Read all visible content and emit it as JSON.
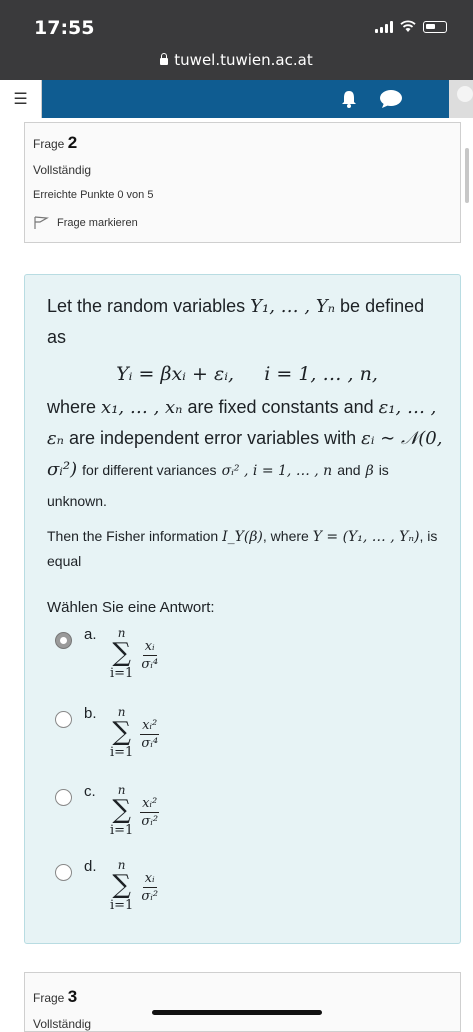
{
  "status_bar": {
    "time": "17:55",
    "url": "tuwel.tuwien.ac.at"
  },
  "nav": {
    "menu_icon": "hamburger-icon",
    "notification_icon": "bell-icon",
    "message_icon": "chat-icon",
    "brand_color": "#0f5c91"
  },
  "question_info": {
    "label": "Frage",
    "number": "2",
    "state": "Vollständig",
    "grade": "Erreichte Punkte 0 von 5",
    "flag_label": "Frage markieren"
  },
  "question": {
    "p1_a": "Let the random variables",
    "p1_vars": "Y₁, … , Yₙ",
    "p1_b": "be defined as",
    "equation": "Yᵢ = βxᵢ + εᵢ,     i = 1, … , n,",
    "p2_a": "where",
    "p2_x": "x₁, … , xₙ",
    "p2_b": "are fixed constants and",
    "p2_eps": "ε₁, … , εₙ",
    "p2_c": "are independent error variables with",
    "p2_dist": "εᵢ ∼ 𝒩(0, σᵢ²)",
    "p2_d": "for different variances",
    "p2_var": "σᵢ² , i = 1, … , n",
    "p2_e": "and",
    "p2_beta": "β",
    "p2_f": "is unknown.",
    "p3_a": "Then the Fisher information",
    "p3_info": "I_Y(β)",
    "p3_b": ", where",
    "p3_y": "Y = (Y₁, … , Yₙ)",
    "p3_c": ", is equal",
    "prompt": "Wählen Sie eine Antwort:"
  },
  "options": [
    {
      "label": "a.",
      "sum_top": "n",
      "sum_bottom": "i=1",
      "num": "xᵢ",
      "den": "σᵢ⁴",
      "selected": true
    },
    {
      "label": "b.",
      "sum_top": "n",
      "sum_bottom": "i=1",
      "num": "xᵢ²",
      "den": "σᵢ⁴",
      "selected": false
    },
    {
      "label": "c.",
      "sum_top": "n",
      "sum_bottom": "i=1",
      "num": "xᵢ²",
      "den": "σᵢ²",
      "selected": false
    },
    {
      "label": "d.",
      "sum_top": "n",
      "sum_bottom": "i=1",
      "num": "xᵢ",
      "den": "σᵢ²",
      "selected": false
    }
  ],
  "next_question": {
    "label": "Frage",
    "number": "3",
    "state": "Vollständig"
  }
}
